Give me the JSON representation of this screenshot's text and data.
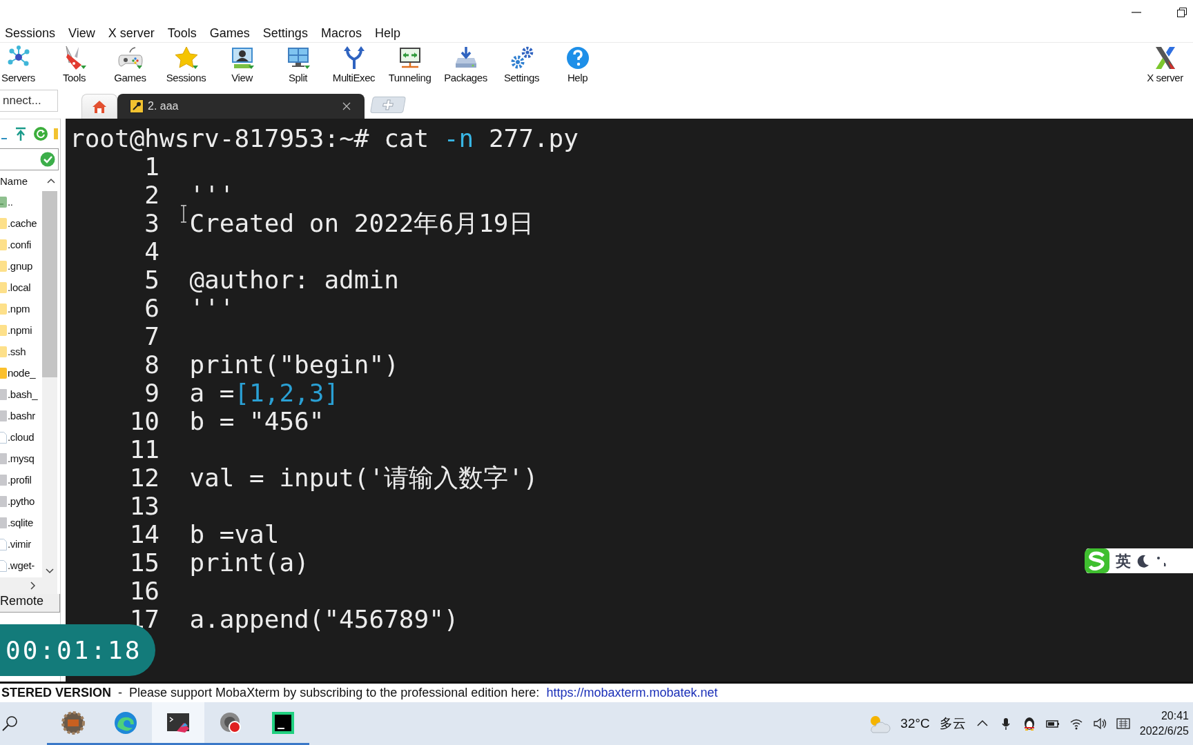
{
  "menu": [
    "Sessions",
    "View",
    "X server",
    "Tools",
    "Games",
    "Settings",
    "Macros",
    "Help"
  ],
  "toolbar": [
    {
      "label": "Servers"
    },
    {
      "label": "Tools"
    },
    {
      "label": "Games"
    },
    {
      "label": "Sessions"
    },
    {
      "label": "View"
    },
    {
      "label": "Split"
    },
    {
      "label": "MultiExec"
    },
    {
      "label": "Tunneling"
    },
    {
      "label": "Packages"
    },
    {
      "label": "Settings"
    },
    {
      "label": "Help"
    }
  ],
  "toolbar_right": {
    "label": "X server"
  },
  "quick_connect": {
    "placeholder": "nnect..."
  },
  "tabs": [
    {
      "kind": "home",
      "selected": false
    },
    {
      "kind": "session",
      "label": "2. aaa",
      "selected": true
    }
  ],
  "sidebar": {
    "header": "Name",
    "files": [
      {
        "name": "..",
        "kind": "up"
      },
      {
        "name": ".cache",
        "kind": "folder"
      },
      {
        "name": ".confi",
        "kind": "folder"
      },
      {
        "name": ".gnup",
        "kind": "folder"
      },
      {
        "name": ".local",
        "kind": "folder"
      },
      {
        "name": ".npm",
        "kind": "folder"
      },
      {
        "name": ".npmi",
        "kind": "folder"
      },
      {
        "name": ".ssh",
        "kind": "folder"
      },
      {
        "name": "node_",
        "kind": "linkfolder"
      },
      {
        "name": ".bash_",
        "kind": "file"
      },
      {
        "name": ".bashr",
        "kind": "file"
      },
      {
        "name": ".cloud",
        "kind": "doc"
      },
      {
        "name": ".mysq",
        "kind": "file"
      },
      {
        "name": ".profil",
        "kind": "file"
      },
      {
        "name": ".pytho",
        "kind": "file"
      },
      {
        "name": ".sqlite",
        "kind": "file"
      },
      {
        "name": ".vimir",
        "kind": "doc"
      },
      {
        "name": ".wget-",
        "kind": "doc"
      }
    ],
    "bottom_tab": "Remote"
  },
  "terminal": {
    "prompt": [
      {
        "text": "root@hwsrv-817953:~# cat ",
        "kind": "plain"
      },
      {
        "text": "-n",
        "kind": "option"
      },
      {
        "text": " 277.py",
        "kind": "plain"
      }
    ],
    "lines": [
      {
        "number": "1"
      },
      {
        "number": "2",
        "code": [
          {
            "text": "'''",
            "kind": "plain"
          }
        ]
      },
      {
        "number": "3",
        "code": [
          {
            "text": "Created on 2022年6月19日",
            "kind": "plain"
          }
        ]
      },
      {
        "number": "4"
      },
      {
        "number": "5",
        "code": [
          {
            "text": "@author: admin",
            "kind": "plain"
          }
        ]
      },
      {
        "number": "6",
        "code": [
          {
            "text": "'''",
            "kind": "plain"
          }
        ]
      },
      {
        "number": "7"
      },
      {
        "number": "8",
        "code": [
          {
            "text": "print(\"begin\")",
            "kind": "plain"
          }
        ]
      },
      {
        "number": "9",
        "code": [
          {
            "text": "a =",
            "kind": "plain"
          },
          {
            "text": "[1,2,3]",
            "kind": "bracket"
          }
        ]
      },
      {
        "number": "10",
        "code": [
          {
            "text": "b = \"456\"",
            "kind": "plain"
          }
        ]
      },
      {
        "number": "11"
      },
      {
        "number": "12",
        "code": [
          {
            "text": "val = input('请输入数字')",
            "kind": "plain"
          }
        ]
      },
      {
        "number": "13"
      },
      {
        "number": "14",
        "code": [
          {
            "text": "b =val",
            "kind": "plain"
          }
        ]
      },
      {
        "number": "15",
        "code": [
          {
            "text": "print(a)",
            "kind": "plain"
          }
        ]
      },
      {
        "number": "16"
      },
      {
        "number": "17",
        "code": [
          {
            "text": "a.append(\"456789\")",
            "kind": "plain"
          }
        ]
      }
    ]
  },
  "timer": "00:01:18",
  "ime": {
    "label": "英"
  },
  "status_bar": {
    "text": "**STERED VERSION**  -  Please support MobaXterm by subscribing to the professional edition here:  ",
    "link": "https://mobaxterm.mobatek.net"
  },
  "taskbar": {
    "apps": [
      {
        "selected": false
      },
      {
        "selected": false
      },
      {
        "selected": true
      },
      {
        "selected": false
      },
      {
        "selected": false
      }
    ]
  },
  "tray": {
    "temperature": "32°C",
    "weather": "多云",
    "time": "20:41",
    "date": "2022/6/25"
  }
}
